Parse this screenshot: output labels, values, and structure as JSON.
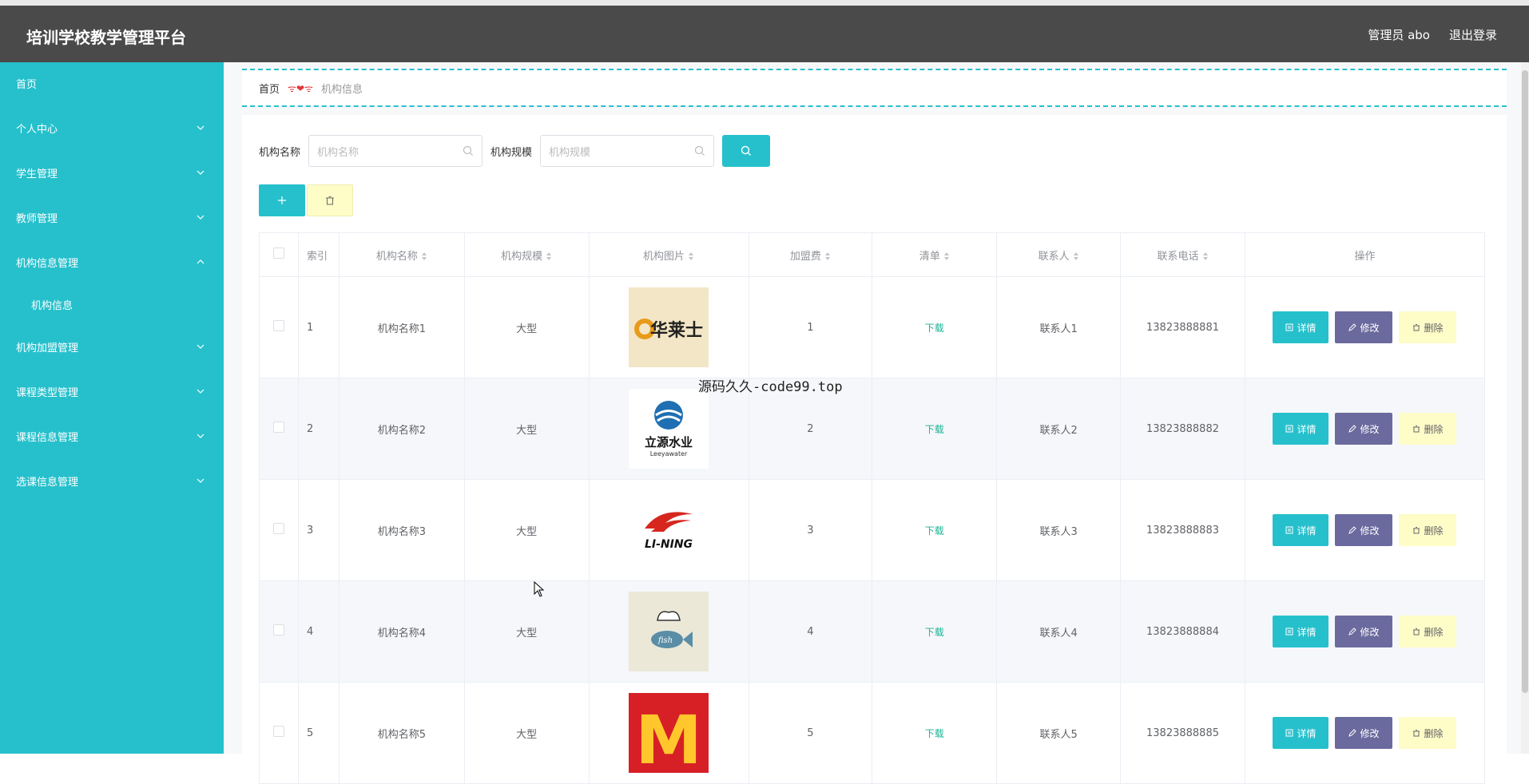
{
  "header": {
    "app_title": "培训学校教学管理平台",
    "user_label": "管理员 abo",
    "logout_label": "退出登录"
  },
  "sidebar": {
    "items": [
      {
        "label": "首页",
        "expandable": false
      },
      {
        "label": "个人中心",
        "expandable": true
      },
      {
        "label": "学生管理",
        "expandable": true
      },
      {
        "label": "教师管理",
        "expandable": true
      },
      {
        "label": "机构信息管理",
        "expandable": true,
        "expanded": true
      },
      {
        "label": "机构信息",
        "expandable": false,
        "sub": true
      },
      {
        "label": "机构加盟管理",
        "expandable": true
      },
      {
        "label": "课程类型管理",
        "expandable": true
      },
      {
        "label": "课程信息管理",
        "expandable": true
      },
      {
        "label": "选课信息管理",
        "expandable": true
      }
    ]
  },
  "breadcrumb": {
    "home": "首页",
    "separator": "ᯤ❤ᯤ",
    "current": "机构信息"
  },
  "search": {
    "name_label": "机构名称",
    "name_placeholder": "机构名称",
    "scale_label": "机构规模",
    "scale_placeholder": "机构规模"
  },
  "table": {
    "headers": {
      "index": "索引",
      "name": "机构名称",
      "scale": "机构规模",
      "image": "机构图片",
      "fee": "加盟费",
      "list": "清单",
      "contact": "联系人",
      "phone": "联系电话",
      "ops": "操作"
    },
    "rows": [
      {
        "index": "1",
        "name": "机构名称1",
        "scale": "大型",
        "logo": "华莱士",
        "fee": "1",
        "list": "下载",
        "contact": "联系人1",
        "phone": "13823888881"
      },
      {
        "index": "2",
        "name": "机构名称2",
        "scale": "大型",
        "logo": "立源水业",
        "logo_sub": "Leeyawater",
        "fee": "2",
        "list": "下载",
        "contact": "联系人2",
        "phone": "13823888882"
      },
      {
        "index": "3",
        "name": "机构名称3",
        "scale": "大型",
        "logo": "LI-NING",
        "fee": "3",
        "list": "下载",
        "contact": "联系人3",
        "phone": "13823888883"
      },
      {
        "index": "4",
        "name": "机构名称4",
        "scale": "大型",
        "logo": "fish",
        "fee": "4",
        "list": "下载",
        "contact": "联系人4",
        "phone": "13823888884"
      },
      {
        "index": "5",
        "name": "机构名称5",
        "scale": "大型",
        "logo": "M",
        "fee": "5",
        "list": "下载",
        "contact": "联系人5",
        "phone": "13823888885"
      }
    ],
    "op_labels": {
      "detail": "详情",
      "edit": "修改",
      "delete": "删除"
    }
  },
  "watermark_text": "源码久久-code99.top",
  "colors": {
    "accent": "#26c0cc",
    "topbar": "#4a4a4a",
    "edit_button": "#6b6a9e",
    "delete_button": "#fefcc7",
    "download_link": "#1ab394"
  }
}
